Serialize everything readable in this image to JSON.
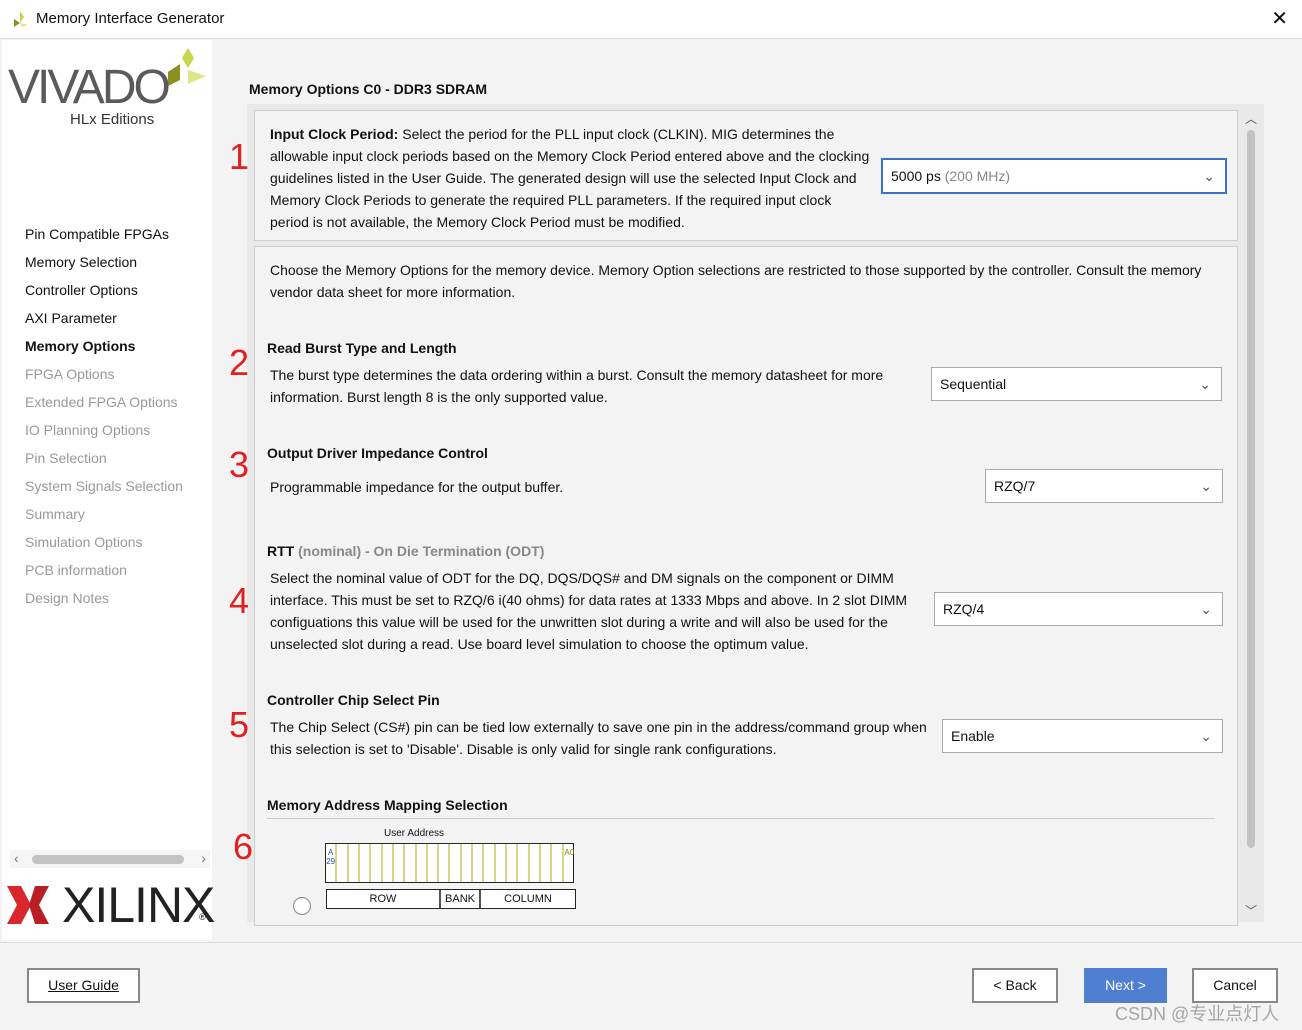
{
  "window": {
    "title": "Memory Interface Generator",
    "close": "✕"
  },
  "sidebar": {
    "logo_top": "VIVADO",
    "logo_sub": "HLx Editions",
    "logo_bottom": "XILINX",
    "registered": "®",
    "items": [
      {
        "label": "Pin Compatible FPGAs",
        "state": "done"
      },
      {
        "label": "Memory Selection",
        "state": "done"
      },
      {
        "label": "Controller Options",
        "state": "done"
      },
      {
        "label": "AXI Parameter",
        "state": "done"
      },
      {
        "label": "Memory Options",
        "state": "active"
      },
      {
        "label": "FPGA Options",
        "state": "disabled"
      },
      {
        "label": "Extended FPGA Options",
        "state": "disabled"
      },
      {
        "label": "IO Planning Options",
        "state": "disabled"
      },
      {
        "label": "Pin Selection",
        "state": "disabled"
      },
      {
        "label": "System Signals Selection",
        "state": "disabled"
      },
      {
        "label": "Summary",
        "state": "disabled"
      },
      {
        "label": "Simulation Options",
        "state": "disabled"
      },
      {
        "label": "PCB information",
        "state": "disabled"
      },
      {
        "label": "Design Notes",
        "state": "disabled"
      }
    ]
  },
  "main": {
    "heading": "Memory Options C0 - DDR3 SDRAM",
    "input_clock": {
      "label": "Input Clock Period:",
      "text": "Select the period for the PLL input clock (CLKIN). MIG determines the allowable input clock periods based on the Memory Clock Period entered above and the clocking guidelines listed in the User Guide. The generated design will use the selected Input Clock and Memory Clock Periods to generate the required PLL parameters. If the required input clock period is not available, the Memory Clock Period must be modified.",
      "value": "5000 ps",
      "value_hint": "(200 MHz)"
    },
    "intro": "Choose the Memory Options for the memory device. Memory Option selections are restricted to those supported by the controller. Consult the memory vendor data sheet for more information.",
    "burst": {
      "title": "Read Burst Type and Length",
      "text": "The burst type determines the data ordering within a burst. Consult the memory datasheet for more information. Burst length 8 is the only supported value.",
      "value": "Sequential"
    },
    "odic": {
      "title": "Output Driver Impedance Control",
      "text": "Programmable impedance for the output buffer.",
      "value": "RZQ/7"
    },
    "rtt": {
      "title_a": "RTT",
      "title_b": "(nominal) - On Die Termination (ODT)",
      "text": "Select the nominal value of ODT for the DQ, DQS/DQS# and DM signals on the component or DIMM interface. This must be set to RZQ/6 i(40 ohms) for data rates at 1333 Mbps and above. In 2 slot DIMM configuations this value will be used for the unwritten slot during a write and will also be used for the unselected slot during a read. Use board level simulation to choose the optimum value.",
      "value": "RZQ/4"
    },
    "cs": {
      "title": "Controller Chip Select Pin",
      "text": "The Chip Select (CS#) pin can be tied low externally to save one pin in the address/command group when this selection is set to 'Disable'. Disable is only valid for single rank configurations.",
      "value": "Enable"
    },
    "mapping": {
      "title": "Memory Address Mapping Selection",
      "user_address": "User Address",
      "msb": "A29",
      "lsb": "A0",
      "fields": [
        "ROW",
        "BANK",
        "COLUMN"
      ]
    }
  },
  "annotations": [
    "1",
    "2",
    "3",
    "4",
    "5",
    "6"
  ],
  "footer": {
    "user_guide": "User Guide",
    "back": "< Back",
    "next": "Next >",
    "cancel": "Cancel",
    "watermark": "CSDN @专业点灯人"
  },
  "colors": {
    "next_button": "#4f7fd0",
    "annotation": "#e02020",
    "focus_border": "#3b6fc9"
  }
}
